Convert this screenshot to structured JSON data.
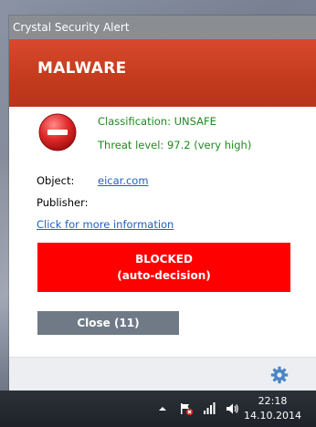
{
  "window": {
    "title": "Crystal Security Alert",
    "header": "MALWARE"
  },
  "detection": {
    "classification": "Classification: UNSAFE",
    "threat_level": "Threat level: 97.2 (very high)",
    "icon": "stop-icon"
  },
  "details": {
    "object_label": "Object:",
    "object_value": "eicar.com",
    "publisher_label": "Publisher:",
    "publisher_value": "",
    "more_info_link": "Click for more information"
  },
  "status": {
    "line1": "BLOCKED",
    "line2": "(auto-decision)",
    "color": "#ff0000"
  },
  "actions": {
    "close_label": "Close (11)"
  },
  "footer": {
    "settings_icon": "gear-icon"
  },
  "taskbar": {
    "time": "22:18",
    "date": "14.10.2014",
    "tray_icons": [
      "show-hidden-icons-chevron",
      "action-center-flag-icon",
      "network-icon",
      "volume-icon"
    ]
  },
  "colors": {
    "header_red": "#c33a1d",
    "safe_text_green": "#1e8a1e",
    "link_blue": "#2060c0",
    "button_gray": "#6f7a86"
  }
}
